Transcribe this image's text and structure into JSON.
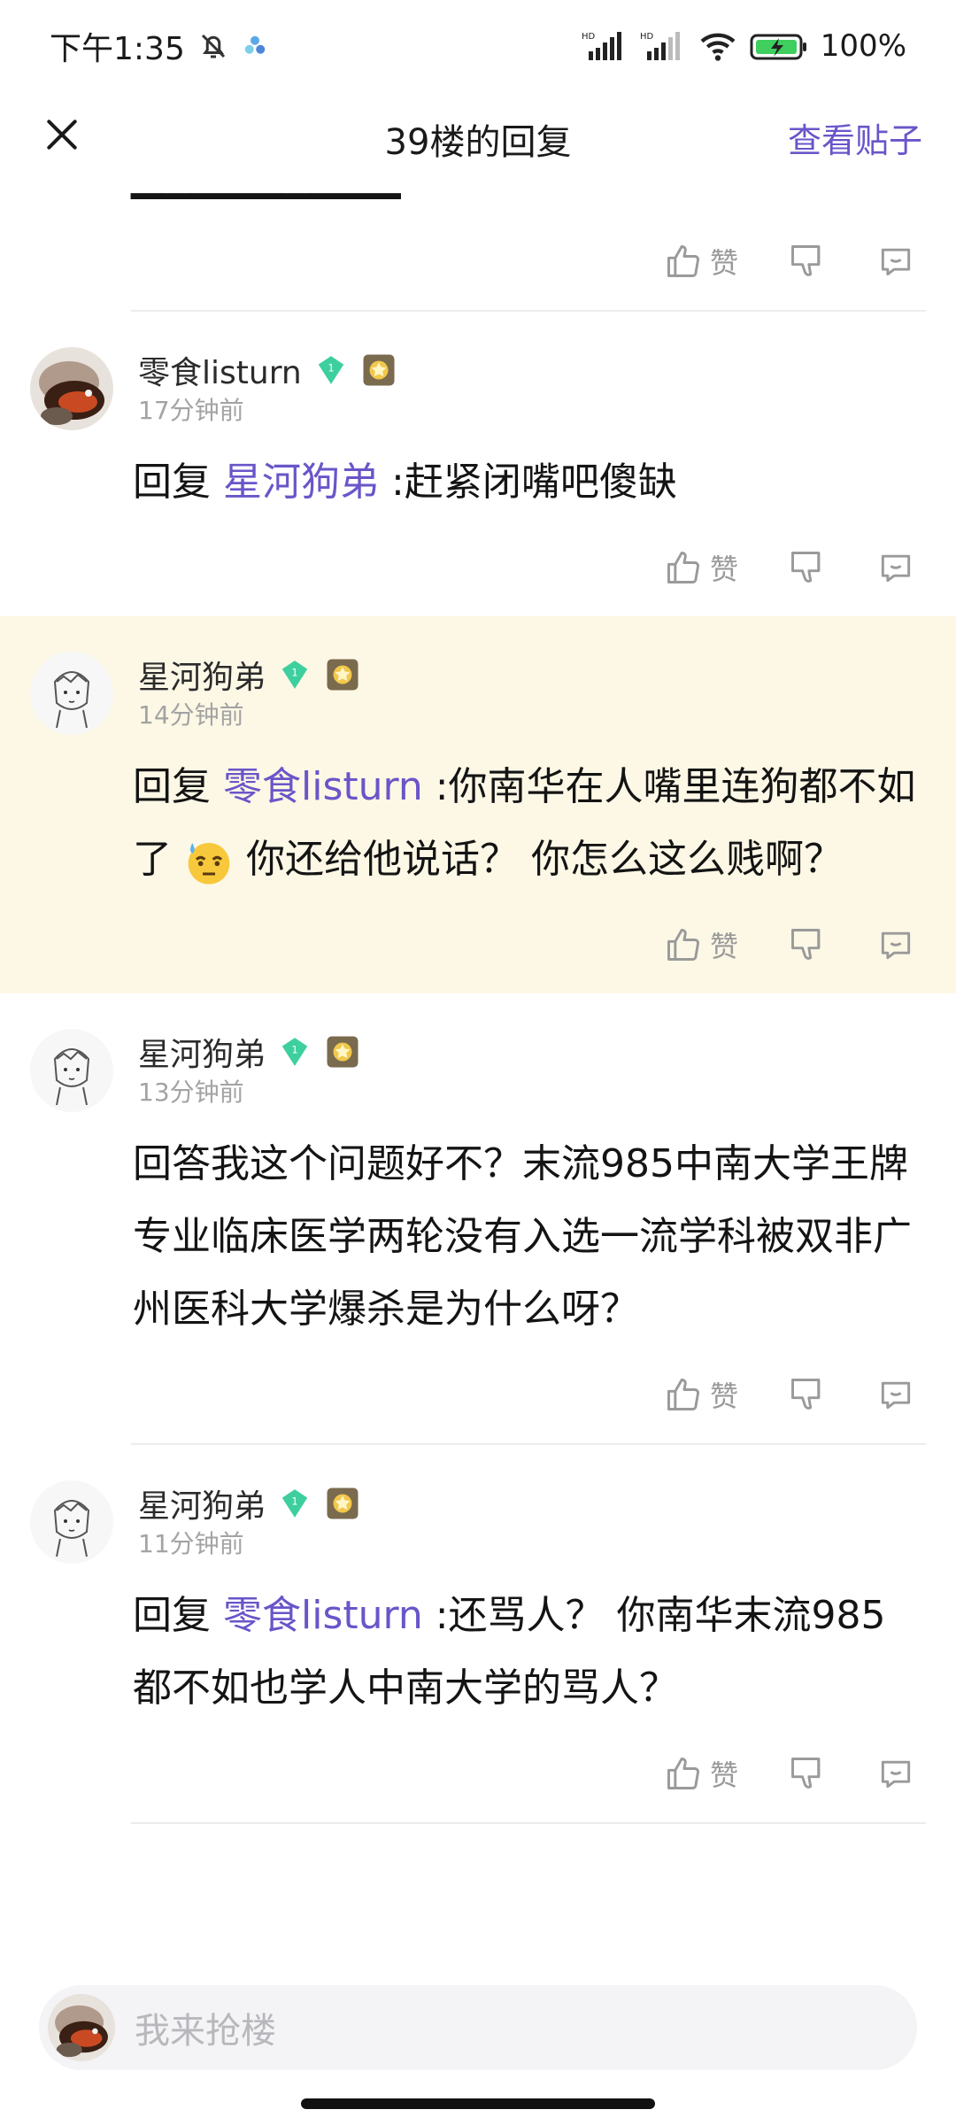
{
  "status_bar": {
    "time": "下午1:35",
    "battery": "100%",
    "icons": [
      "bell-muted-icon",
      "app-notification-icon",
      "hd-signal-icon",
      "hd-signal-icon",
      "wifi-icon",
      "battery-charging-icon"
    ]
  },
  "header": {
    "title": "39楼的回复",
    "view_post": "查看贴子",
    "close_icon": "close-icon"
  },
  "actions": {
    "like_label": "赞"
  },
  "comments": [
    {
      "username": "零食listurn",
      "time": "17分钟前",
      "reply_prefix": "回复",
      "mention": "星河狗弟",
      "text": ":赶紧闭嘴吧傻缺",
      "level": "1"
    },
    {
      "username": "星河狗弟",
      "time": "14分钟前",
      "reply_prefix": "回复",
      "mention": "零食listurn",
      "text_part1": ":你南华在人嘴里连狗都不如了",
      "text_part2": "你还给他说话？ 你怎么这么贱啊？",
      "level": "1"
    },
    {
      "username": "星河狗弟",
      "time": "13分钟前",
      "text": "回答我这个问题好不？末流985中南大学王牌专业临床医学两轮没有入选一流学科被双非广州医科大学爆杀是为什么呀？",
      "level": "1"
    },
    {
      "username": "星河狗弟",
      "time": "11分钟前",
      "reply_prefix": "回复",
      "mention": "零食listurn",
      "text": ":还骂人？ 你南华末流985都不如也学人中南大学的骂人？",
      "level": "1"
    }
  ],
  "bottom_bar": {
    "placeholder": "我来抢楼"
  },
  "colors": {
    "accent": "#6a55c9",
    "highlight_bg": "#fdf8e6",
    "level_badge": "#3ecf9e"
  }
}
